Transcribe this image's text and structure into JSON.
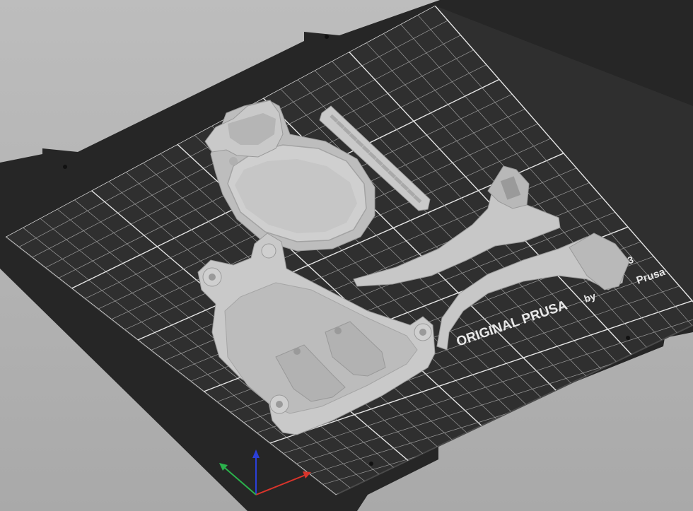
{
  "viewport": {
    "background_color": "#b4b4b4",
    "bed_color": "#2b2b2b",
    "grid_color": "#d9d9d9",
    "model_color": "#c8c8c8"
  },
  "bed": {
    "logo_main": "ORIGINAL PRUSA",
    "logo_model": "K3",
    "logo_by": "by",
    "logo_brand": "Prusa"
  },
  "objects": [
    {
      "name": "upper-shell"
    },
    {
      "name": "rack-bar"
    },
    {
      "name": "curved-arm-right-upper"
    },
    {
      "name": "curved-arm-right-lower"
    },
    {
      "name": "base-plate"
    }
  ],
  "axes": {
    "x_color": "#d9342b",
    "y_color": "#2bb24c",
    "z_color": "#2b3fd9"
  }
}
